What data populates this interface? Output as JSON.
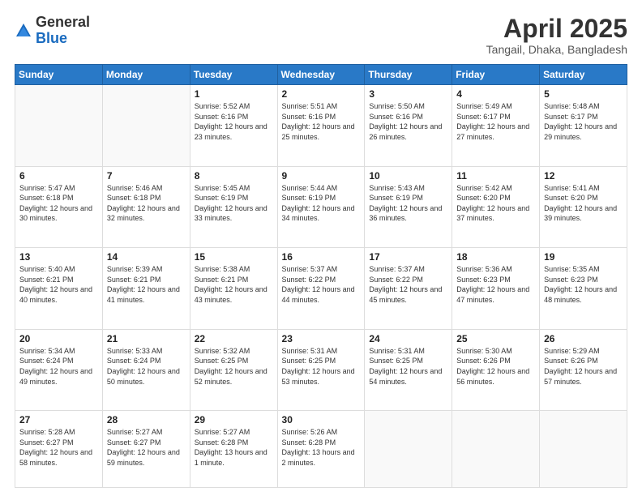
{
  "logo": {
    "general": "General",
    "blue": "Blue"
  },
  "title": "April 2025",
  "subtitle": "Tangail, Dhaka, Bangladesh",
  "weekdays": [
    "Sunday",
    "Monday",
    "Tuesday",
    "Wednesday",
    "Thursday",
    "Friday",
    "Saturday"
  ],
  "weeks": [
    [
      {
        "day": "",
        "info": ""
      },
      {
        "day": "",
        "info": ""
      },
      {
        "day": "1",
        "info": "Sunrise: 5:52 AM\nSunset: 6:16 PM\nDaylight: 12 hours and 23 minutes."
      },
      {
        "day": "2",
        "info": "Sunrise: 5:51 AM\nSunset: 6:16 PM\nDaylight: 12 hours and 25 minutes."
      },
      {
        "day": "3",
        "info": "Sunrise: 5:50 AM\nSunset: 6:16 PM\nDaylight: 12 hours and 26 minutes."
      },
      {
        "day": "4",
        "info": "Sunrise: 5:49 AM\nSunset: 6:17 PM\nDaylight: 12 hours and 27 minutes."
      },
      {
        "day": "5",
        "info": "Sunrise: 5:48 AM\nSunset: 6:17 PM\nDaylight: 12 hours and 29 minutes."
      }
    ],
    [
      {
        "day": "6",
        "info": "Sunrise: 5:47 AM\nSunset: 6:18 PM\nDaylight: 12 hours and 30 minutes."
      },
      {
        "day": "7",
        "info": "Sunrise: 5:46 AM\nSunset: 6:18 PM\nDaylight: 12 hours and 32 minutes."
      },
      {
        "day": "8",
        "info": "Sunrise: 5:45 AM\nSunset: 6:19 PM\nDaylight: 12 hours and 33 minutes."
      },
      {
        "day": "9",
        "info": "Sunrise: 5:44 AM\nSunset: 6:19 PM\nDaylight: 12 hours and 34 minutes."
      },
      {
        "day": "10",
        "info": "Sunrise: 5:43 AM\nSunset: 6:19 PM\nDaylight: 12 hours and 36 minutes."
      },
      {
        "day": "11",
        "info": "Sunrise: 5:42 AM\nSunset: 6:20 PM\nDaylight: 12 hours and 37 minutes."
      },
      {
        "day": "12",
        "info": "Sunrise: 5:41 AM\nSunset: 6:20 PM\nDaylight: 12 hours and 39 minutes."
      }
    ],
    [
      {
        "day": "13",
        "info": "Sunrise: 5:40 AM\nSunset: 6:21 PM\nDaylight: 12 hours and 40 minutes."
      },
      {
        "day": "14",
        "info": "Sunrise: 5:39 AM\nSunset: 6:21 PM\nDaylight: 12 hours and 41 minutes."
      },
      {
        "day": "15",
        "info": "Sunrise: 5:38 AM\nSunset: 6:21 PM\nDaylight: 12 hours and 43 minutes."
      },
      {
        "day": "16",
        "info": "Sunrise: 5:37 AM\nSunset: 6:22 PM\nDaylight: 12 hours and 44 minutes."
      },
      {
        "day": "17",
        "info": "Sunrise: 5:37 AM\nSunset: 6:22 PM\nDaylight: 12 hours and 45 minutes."
      },
      {
        "day": "18",
        "info": "Sunrise: 5:36 AM\nSunset: 6:23 PM\nDaylight: 12 hours and 47 minutes."
      },
      {
        "day": "19",
        "info": "Sunrise: 5:35 AM\nSunset: 6:23 PM\nDaylight: 12 hours and 48 minutes."
      }
    ],
    [
      {
        "day": "20",
        "info": "Sunrise: 5:34 AM\nSunset: 6:24 PM\nDaylight: 12 hours and 49 minutes."
      },
      {
        "day": "21",
        "info": "Sunrise: 5:33 AM\nSunset: 6:24 PM\nDaylight: 12 hours and 50 minutes."
      },
      {
        "day": "22",
        "info": "Sunrise: 5:32 AM\nSunset: 6:25 PM\nDaylight: 12 hours and 52 minutes."
      },
      {
        "day": "23",
        "info": "Sunrise: 5:31 AM\nSunset: 6:25 PM\nDaylight: 12 hours and 53 minutes."
      },
      {
        "day": "24",
        "info": "Sunrise: 5:31 AM\nSunset: 6:25 PM\nDaylight: 12 hours and 54 minutes."
      },
      {
        "day": "25",
        "info": "Sunrise: 5:30 AM\nSunset: 6:26 PM\nDaylight: 12 hours and 56 minutes."
      },
      {
        "day": "26",
        "info": "Sunrise: 5:29 AM\nSunset: 6:26 PM\nDaylight: 12 hours and 57 minutes."
      }
    ],
    [
      {
        "day": "27",
        "info": "Sunrise: 5:28 AM\nSunset: 6:27 PM\nDaylight: 12 hours and 58 minutes."
      },
      {
        "day": "28",
        "info": "Sunrise: 5:27 AM\nSunset: 6:27 PM\nDaylight: 12 hours and 59 minutes."
      },
      {
        "day": "29",
        "info": "Sunrise: 5:27 AM\nSunset: 6:28 PM\nDaylight: 13 hours and 1 minute."
      },
      {
        "day": "30",
        "info": "Sunrise: 5:26 AM\nSunset: 6:28 PM\nDaylight: 13 hours and 2 minutes."
      },
      {
        "day": "",
        "info": ""
      },
      {
        "day": "",
        "info": ""
      },
      {
        "day": "",
        "info": ""
      }
    ]
  ]
}
